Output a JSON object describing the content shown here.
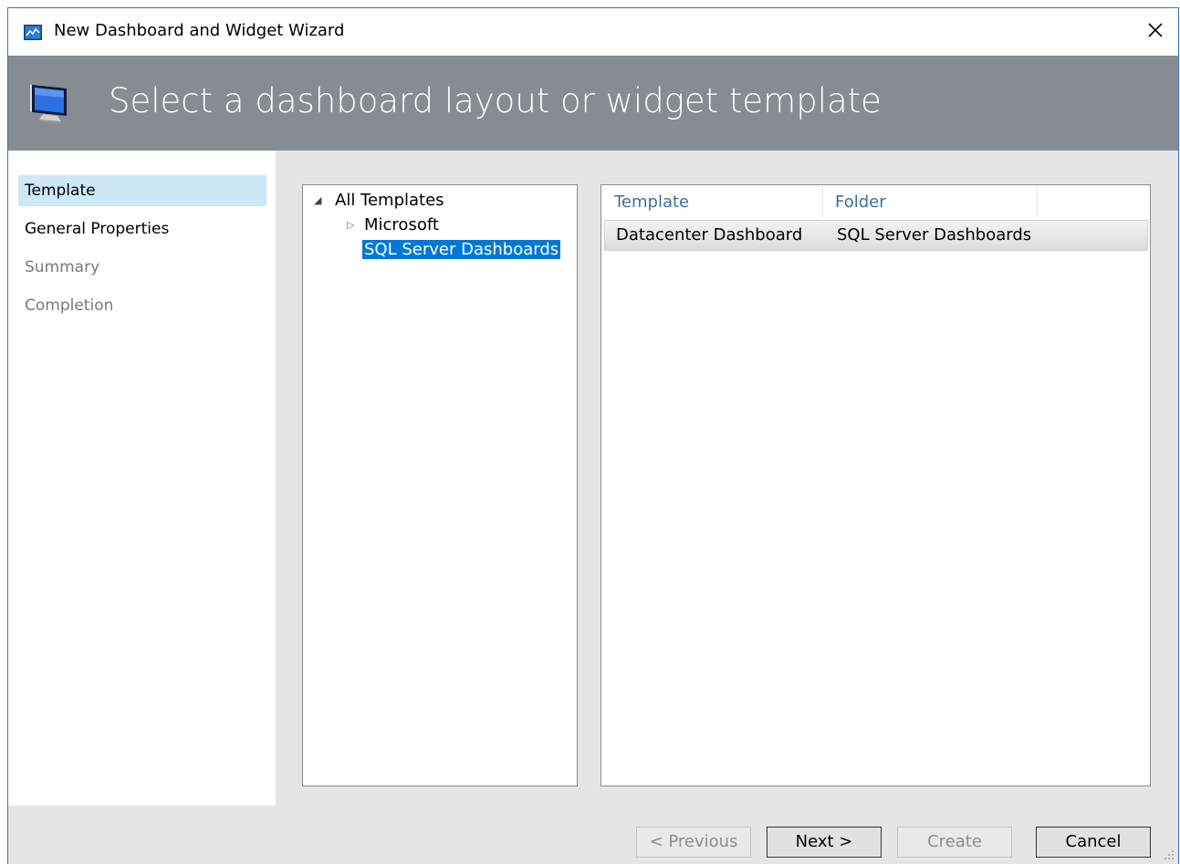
{
  "window": {
    "title": "New Dashboard and Widget Wizard",
    "close_icon": "close-icon"
  },
  "banner": {
    "title": "Select a dashboard layout or widget template",
    "icon": "monitor-icon"
  },
  "nav": {
    "items": [
      {
        "label": "Template",
        "state": "active"
      },
      {
        "label": "General Properties",
        "state": "normal"
      },
      {
        "label": "Summary",
        "state": "disabled"
      },
      {
        "label": "Completion",
        "state": "disabled"
      }
    ]
  },
  "tree": {
    "root": {
      "label": "All Templates",
      "expanded": true
    },
    "children": [
      {
        "label": "Microsoft",
        "expandable": true
      },
      {
        "label": "SQL Server Dashboards",
        "selected": true
      }
    ]
  },
  "list": {
    "columns": [
      "Template",
      "Folder"
    ],
    "rows": [
      {
        "template": "Datacenter Dashboard",
        "folder": "SQL Server Dashboards",
        "selected": true
      }
    ]
  },
  "buttons": {
    "previous": "< Previous",
    "next": "Next >",
    "create": "Create",
    "cancel": "Cancel"
  },
  "colors": {
    "banner": "#868c91",
    "selection": "#0078d7",
    "nav_active": "#cde8f6",
    "column_header": "#3d6f99"
  }
}
